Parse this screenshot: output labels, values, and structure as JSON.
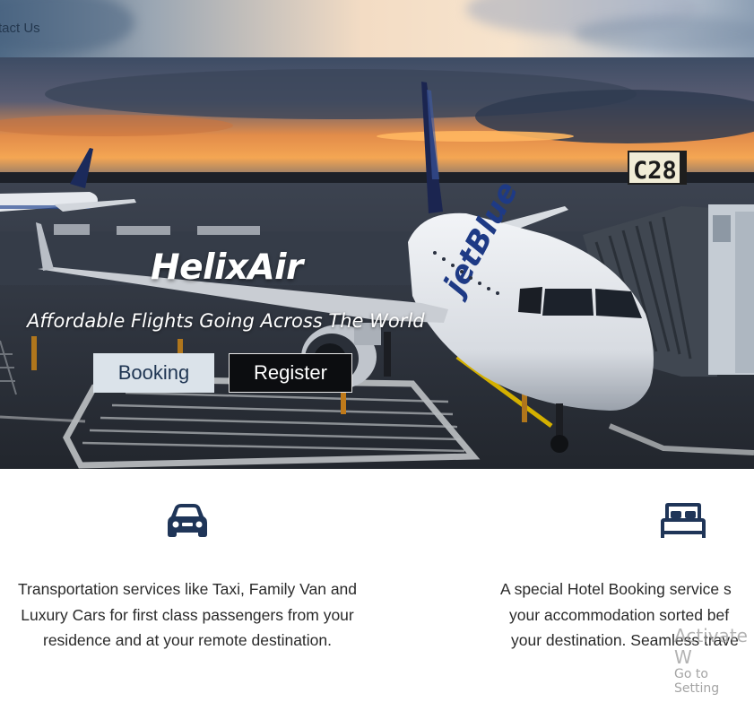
{
  "nav": {
    "contact_label": "tact Us"
  },
  "hero": {
    "brand": "HelixAir",
    "tagline": "Affordable Flights Going Across The World",
    "booking_label": "Booking",
    "register_label": "Register",
    "gate_sign": "C28",
    "plane_livery": "jetBlue"
  },
  "services": [
    {
      "icon": "car-icon",
      "lines": [
        "Transportation services like Taxi, Family Van and",
        "Luxury Cars for first class passengers from your",
        "residence and at your remote destination."
      ]
    },
    {
      "icon": "bed-icon",
      "lines": [
        "A special Hotel Booking service s",
        "your accommodation sorted bef",
        "your destination. Seamless trave"
      ]
    }
  ],
  "watermark": {
    "line1": "Activate W",
    "line2": "Go to Setting"
  },
  "colors": {
    "icon_navy": "#1f3558",
    "booking_bg": "#dbe3ea",
    "register_bg": "#0c0d10"
  }
}
